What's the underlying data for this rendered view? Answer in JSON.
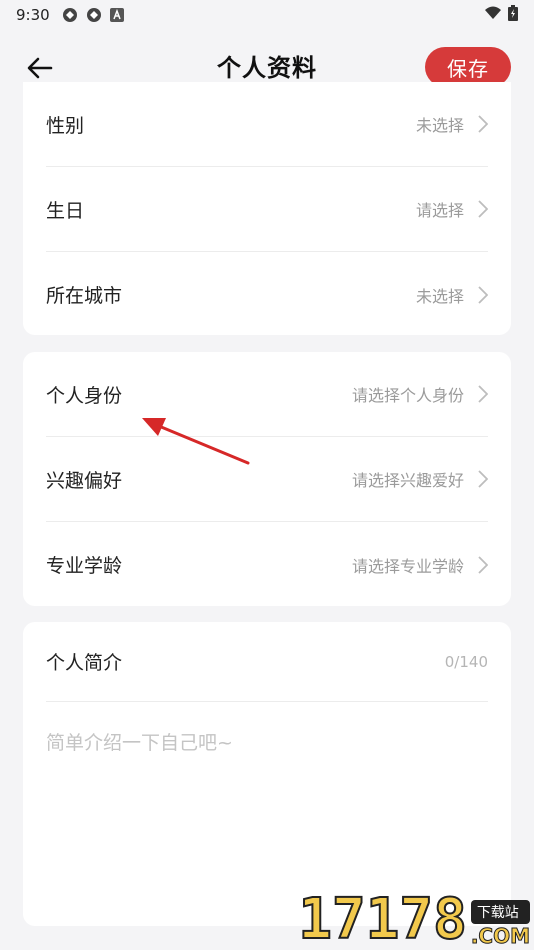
{
  "status_bar": {
    "time": "9:30"
  },
  "header": {
    "title": "个人资料",
    "save_label": "保存"
  },
  "basic_info": [
    {
      "label": "性别",
      "value": "未选择"
    },
    {
      "label": "生日",
      "value": "请选择"
    },
    {
      "label": "所在城市",
      "value": "未选择"
    }
  ],
  "profile_info": [
    {
      "label": "个人身份",
      "value": "请选择个人身份"
    },
    {
      "label": "兴趣偏好",
      "value": "请选择兴趣爱好"
    },
    {
      "label": "专业学龄",
      "value": "请选择专业学龄"
    }
  ],
  "intro": {
    "label": "个人简介",
    "count": "0/140",
    "placeholder": "简单介绍一下自己吧~"
  },
  "watermark": {
    "number": "17178",
    "tag": "下载站",
    "suffix": ".COM"
  },
  "colors": {
    "accent": "#d63a3a",
    "background": "#f4f4f6",
    "annotation": "#d62828"
  }
}
